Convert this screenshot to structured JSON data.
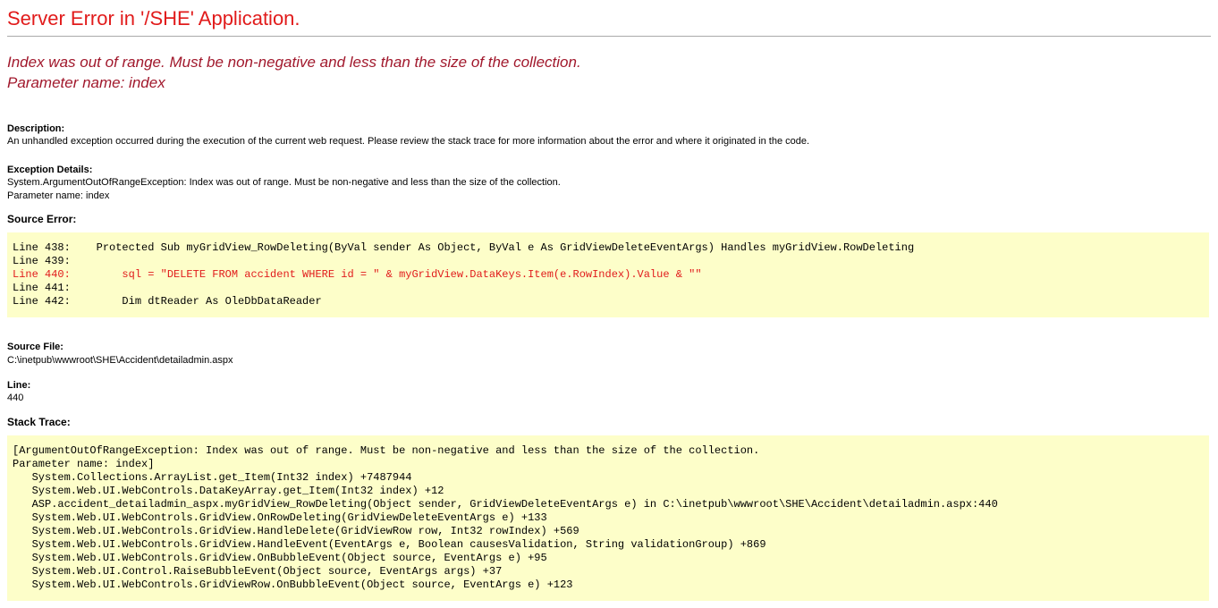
{
  "header": {
    "title": "Server Error in '/SHE' Application."
  },
  "subtitle": "Index was out of range. Must be non-negative and less than the size of the collection.\nParameter name: index",
  "description": {
    "label": "Description:",
    "text": "An unhandled exception occurred during the execution of the current web request. Please review the stack trace for more information about the error and where it originated in the code."
  },
  "exception": {
    "label": "Exception Details:",
    "text": "System.ArgumentOutOfRangeException: Index was out of range. Must be non-negative and less than the size of the collection.\nParameter name: index"
  },
  "sourceError": {
    "heading": "Source Error:",
    "preLines": "Line 438:    Protected Sub myGridView_RowDeleting(ByVal sender As Object, ByVal e As GridViewDeleteEventArgs) Handles myGridView.RowDeleting\nLine 439:",
    "errorLine": "Line 440:        sql = \"DELETE FROM accident WHERE id = \" & myGridView.DataKeys.Item(e.RowIndex).Value & \"\"",
    "postLines": "Line 441:\nLine 442:        Dim dtReader As OleDbDataReader"
  },
  "sourceFile": {
    "label": "Source File:",
    "path": "C:\\inetpub\\wwwroot\\SHE\\Accident\\detailadmin.aspx",
    "lineLabel": "Line:",
    "lineNumber": "440"
  },
  "stackTrace": {
    "heading": "Stack Trace:",
    "text": "[ArgumentOutOfRangeException: Index was out of range. Must be non-negative and less than the size of the collection.\nParameter name: index]\n   System.Collections.ArrayList.get_Item(Int32 index) +7487944\n   System.Web.UI.WebControls.DataKeyArray.get_Item(Int32 index) +12\n   ASP.accident_detailadmin_aspx.myGridView_RowDeleting(Object sender, GridViewDeleteEventArgs e) in C:\\inetpub\\wwwroot\\SHE\\Accident\\detailadmin.aspx:440\n   System.Web.UI.WebControls.GridView.OnRowDeleting(GridViewDeleteEventArgs e) +133\n   System.Web.UI.WebControls.GridView.HandleDelete(GridViewRow row, Int32 rowIndex) +569\n   System.Web.UI.WebControls.GridView.HandleEvent(EventArgs e, Boolean causesValidation, String validationGroup) +869\n   System.Web.UI.WebControls.GridView.OnBubbleEvent(Object source, EventArgs e) +95\n   System.Web.UI.Control.RaiseBubbleEvent(Object source, EventArgs args) +37\n   System.Web.UI.WebControls.GridViewRow.OnBubbleEvent(Object source, EventArgs e) +123"
  }
}
